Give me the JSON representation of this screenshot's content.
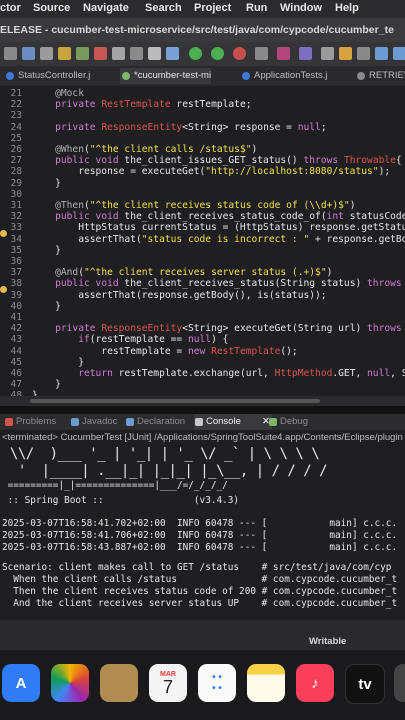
{
  "menubar": {
    "items": [
      "ctor",
      "Source",
      "Navigate",
      "Search",
      "Project",
      "Run",
      "Window",
      "Help"
    ]
  },
  "titlebar": {
    "title": "ELEASE - cucumber-test-microservice/src/test/java/com/cypcode/cucumber_te"
  },
  "editor_tabs": [
    {
      "label": "StatusController.j"
    },
    {
      "label": "*cucumber-test-mi"
    },
    {
      "label": "ApplicationTests.j"
    },
    {
      "label": "RETRIEV"
    }
  ],
  "editor": {
    "lines": [
      {
        "n": "21",
        "t": "    @Mock"
      },
      {
        "n": "22",
        "t": "    private RestTemplate restTemplate;"
      },
      {
        "n": "23",
        "t": ""
      },
      {
        "n": "24",
        "t": "    private ResponseEntity<String> response = null;"
      },
      {
        "n": "25",
        "t": ""
      },
      {
        "n": "26",
        "t": "    @When(\"^the client calls /status$\")"
      },
      {
        "n": "27",
        "t": "    public void the_client_issues_GET_status() throws Throwable{"
      },
      {
        "n": "28",
        "t": "        response = executeGet(\"http://localhost:8080/status\");"
      },
      {
        "n": "29",
        "t": "    }"
      },
      {
        "n": "30",
        "t": ""
      },
      {
        "n": "31",
        "t": "    @Then(\"^the client receives status code of (\\\\d+)$\")"
      },
      {
        "n": "32",
        "t": "    public void the_client_receives_status_code_of(int statusCode"
      },
      {
        "n": "33",
        "t": "        HttpStatus currentStatus = (HttpStatus) response.getStatu"
      },
      {
        "n": "34",
        "t": "        assertThat(\"status code is incorrect : \" + response.getBo"
      },
      {
        "n": "35",
        "t": "    }"
      },
      {
        "n": "36",
        "t": ""
      },
      {
        "n": "37",
        "t": "    @And(\"^the client receives server status (.+)$\")"
      },
      {
        "n": "38",
        "t": "    public void the_client_receives_status(String status) throws"
      },
      {
        "n": "39",
        "t": "        assertThat(response.getBody(), is(status));"
      },
      {
        "n": "40",
        "t": "    }"
      },
      {
        "n": "41",
        "t": ""
      },
      {
        "n": "42",
        "t": "    private ResponseEntity<String> executeGet(String url) throws"
      },
      {
        "n": "43",
        "t": "        if(restTemplate == null) {"
      },
      {
        "n": "44",
        "t": "            restTemplate = new RestTemplate();"
      },
      {
        "n": "45",
        "t": "        }"
      },
      {
        "n": "46",
        "t": "        return restTemplate.exchange(url, HttpMethod.GET, null, S"
      },
      {
        "n": "47",
        "t": "    }"
      },
      {
        "n": "48",
        "t": "}"
      },
      {
        "n": "49",
        "t": ""
      }
    ]
  },
  "panel_tabs": [
    {
      "label": "Problems",
      "icon": "problems-icon",
      "color": "#d9534f"
    },
    {
      "label": "Javadoc",
      "icon": "javadoc-icon",
      "color": "#6b9bd1"
    },
    {
      "label": "Declaration",
      "icon": "declaration-icon",
      "color": "#6b9bd1"
    },
    {
      "label": "Console",
      "icon": "console-icon",
      "color": "#c9c9c9",
      "active": true
    },
    {
      "label": "Debug",
      "icon": "debug-icon",
      "color": "#7fb56b"
    }
  ],
  "console": {
    "header": "<terminated> CucumberTest [JUnit] /Applications/SpringToolSuite4.app/Contents/Eclipse/plugin",
    "banner": [
      " \\\\/  )___ '_ | '_| | '_ \\/ _` | \\ \\ \\ \\",
      "  '  |____| .__|_| |_|_| |_\\__, | / / / /",
      " =========|_|==============|___/=/_/_/_/"
    ],
    "boot": " :: Spring Boot ::                (v3.4.3)",
    "logs": [
      "2025-03-07T16:58:41.702+02:00  INFO 60478 --- [           main] c.c.c.",
      "2025-03-07T16:58:41.706+02:00  INFO 60478 --- [           main] c.c.c.",
      "2025-03-07T16:58:43.887+02:00  INFO 60478 --- [           main] c.c.c."
    ],
    "scenario": [
      "Scenario: client makes call to GET /status    # src/test/java/com/cyp",
      "  When the client calls /status               # com.cypcode.cucumber_t",
      "  Then the client receives status code of 200 # com.cypcode.cucumber_t",
      "  And the client receives server status UP    # com.cypcode.cucumber_t"
    ]
  },
  "statusbar": {
    "mode": "Writable"
  },
  "dock": {
    "calendar_month": "MAR",
    "calendar_day": "7",
    "tv_label": "tv",
    "icons": [
      "app-store-icon",
      "photos-icon",
      "contacts-icon",
      "calendar-icon",
      "reminders-icon",
      "notes-icon",
      "music-icon",
      "apple-tv-icon"
    ]
  }
}
